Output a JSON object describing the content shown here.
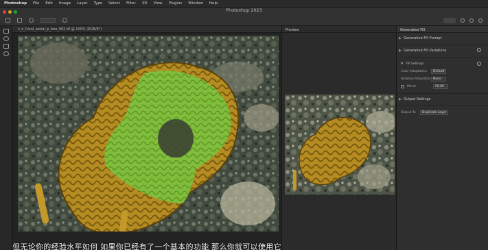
{
  "menubar": {
    "items": [
      "Photoshop",
      "File",
      "Edit",
      "Image",
      "Layer",
      "Type",
      "Select",
      "Filter",
      "3D",
      "View",
      "Plugins",
      "Window",
      "Help"
    ]
  },
  "app_title": "Photoshop 2023",
  "document": {
    "tab_label": "z_z_Coral_aerial_p_boo_002.tif @ 100% (RGB/8*)"
  },
  "preview_panel": {
    "title": "Preview"
  },
  "properties_panel": {
    "title": "Generative Fill",
    "sections": [
      {
        "label": "Generative Fill Prompt"
      },
      {
        "label": "Generative Fill Variations"
      }
    ],
    "settings_header": "Fill Settings",
    "settings": [
      {
        "label": "Color Adaptation",
        "value": "Default"
      },
      {
        "label": "Rotation Adaptation",
        "value": "None"
      }
    ],
    "mirror": {
      "label": "Mirror",
      "value": "50.00"
    },
    "output_section": "Output Settings",
    "output": {
      "label": "Output To",
      "value": "Duplicate Layer"
    }
  },
  "subtitle": "但无论你的经验水平如何 如果你已经有了一个基本的功能 那么你就可以使用它",
  "colors": {
    "accent_green": "#7cc242",
    "coral_yellow": "#b8962a",
    "panel_bg": "#2f2f2f"
  }
}
